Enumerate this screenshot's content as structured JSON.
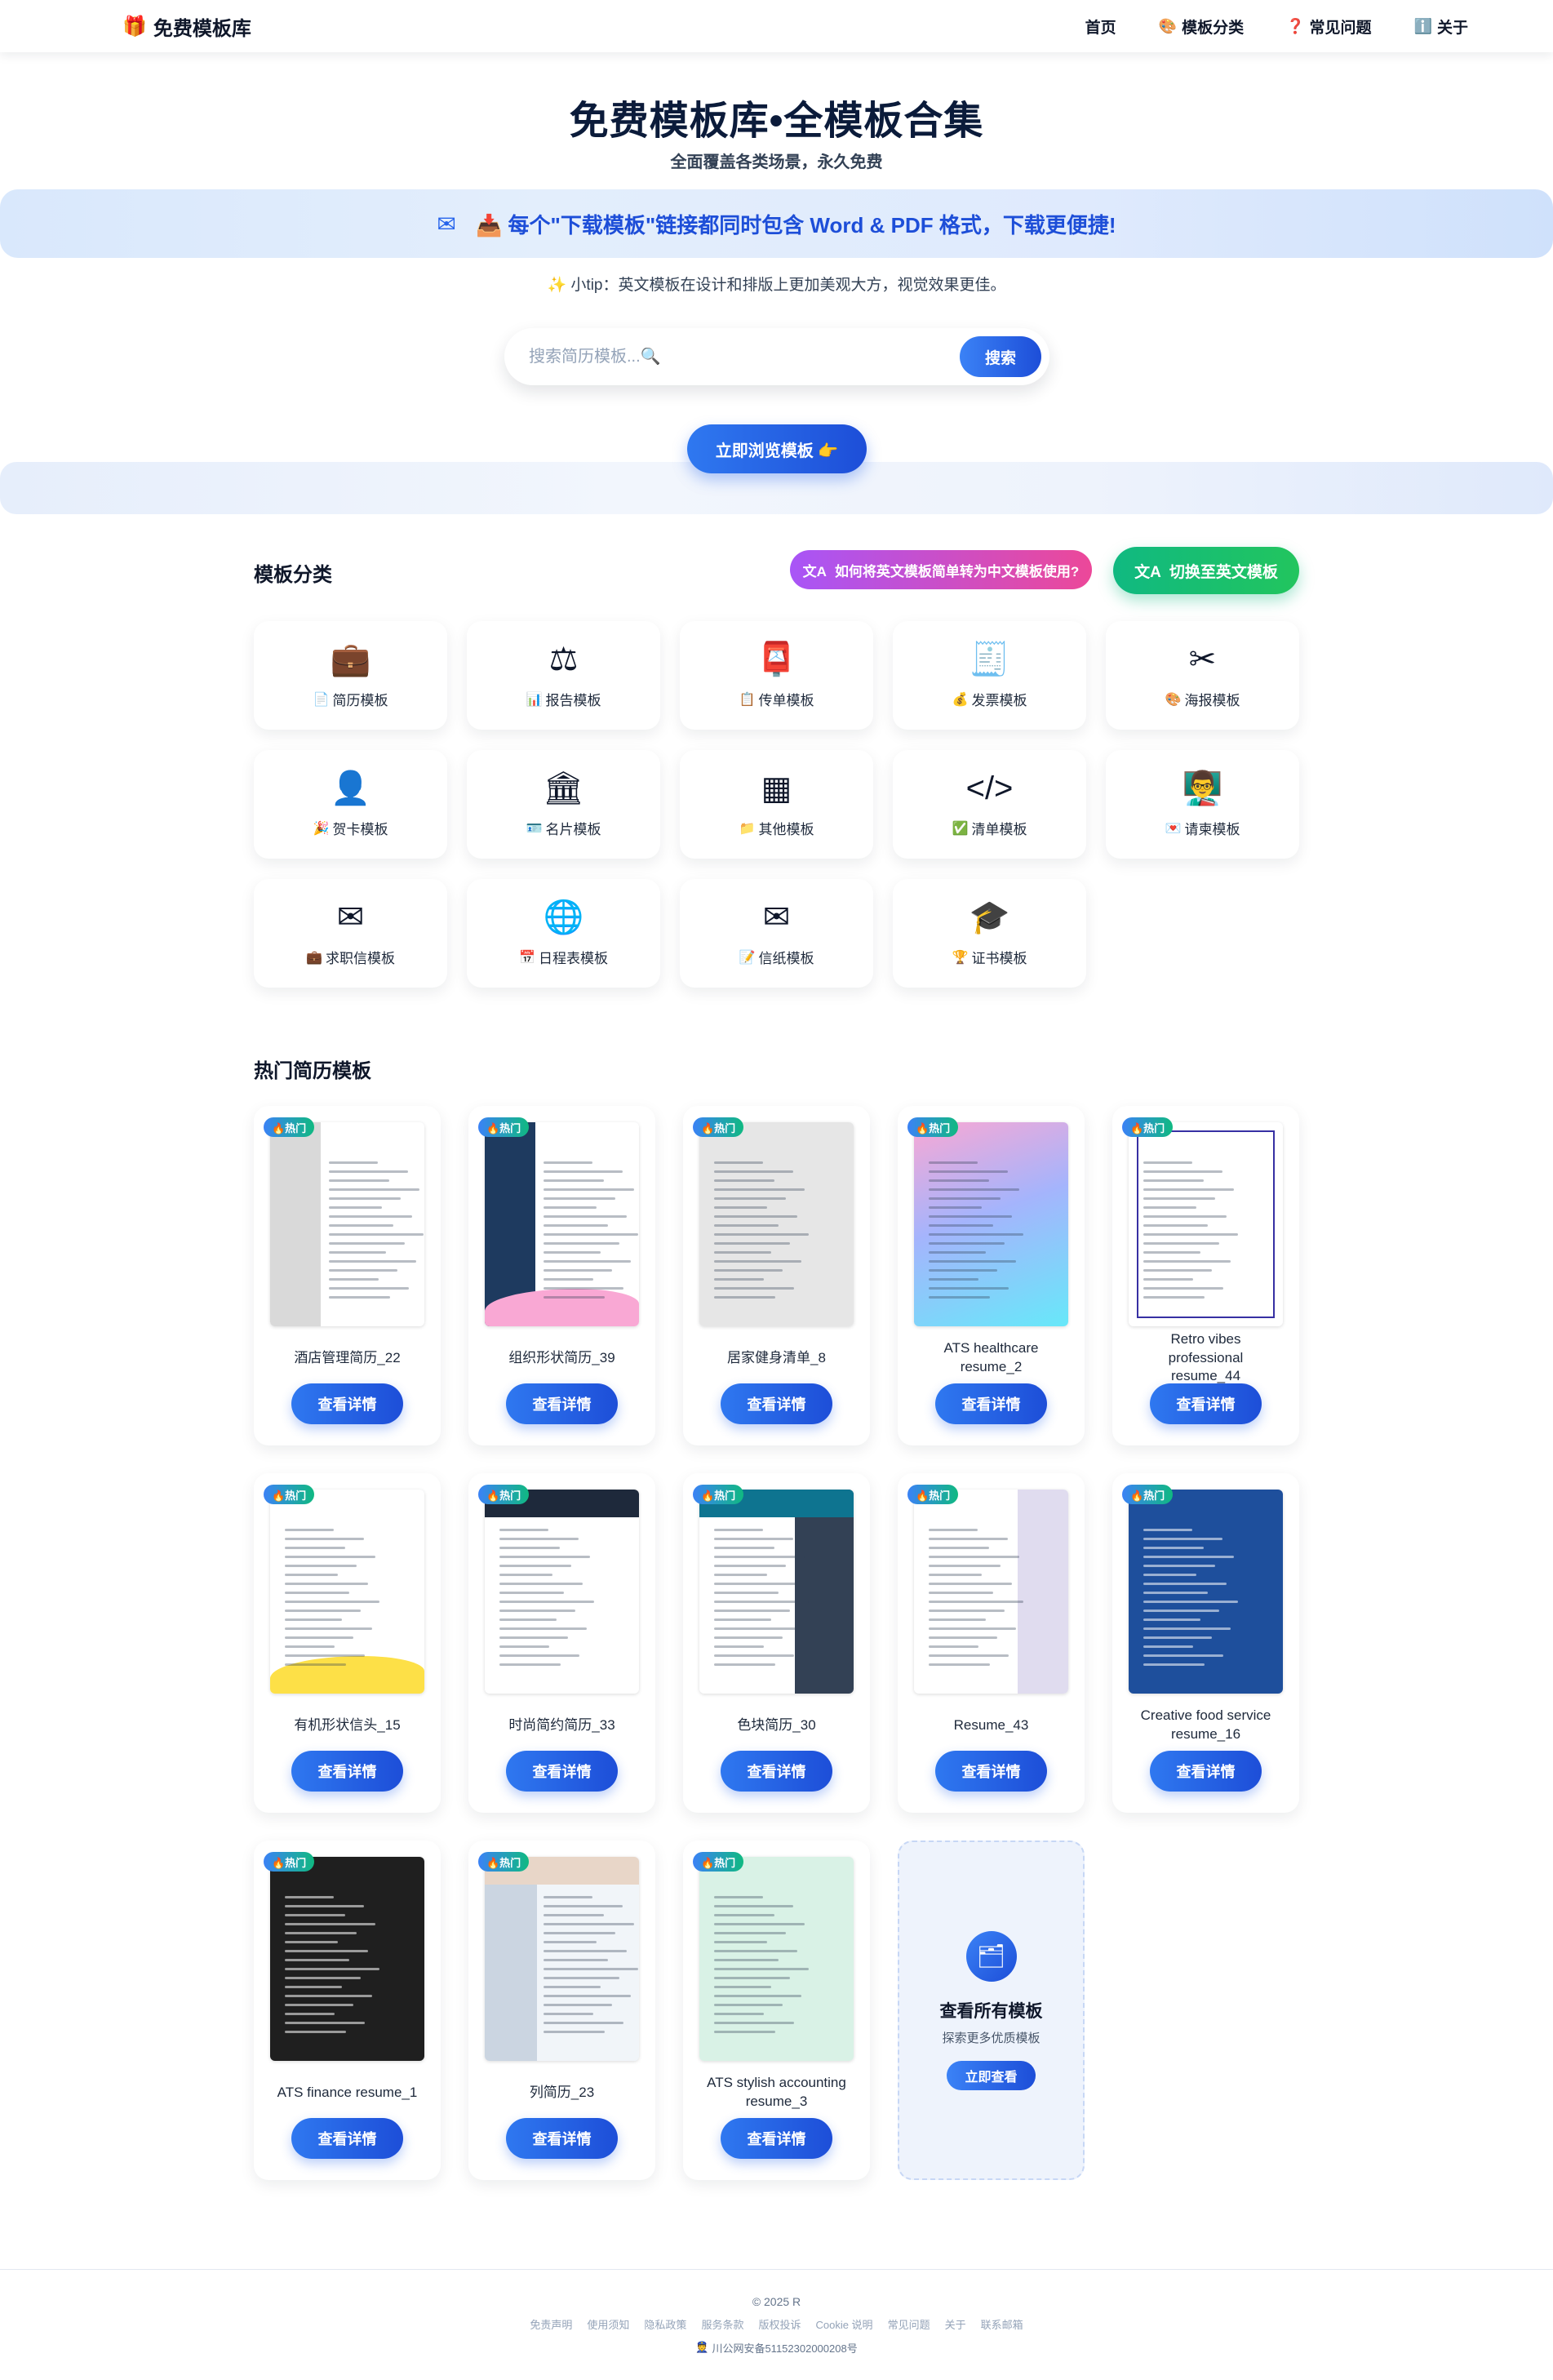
{
  "header": {
    "logo_icon": "🎁",
    "logo_text": "免费模板库",
    "nav": [
      {
        "icon": "",
        "label": "首页"
      },
      {
        "icon": "🎨",
        "label": "模板分类"
      },
      {
        "icon": "❓",
        "label": "常见问题"
      },
      {
        "icon": "ℹ️",
        "label": "关于"
      }
    ]
  },
  "hero": {
    "title": "免费模板库•全模板合集",
    "subtitle": "全面覆盖各类场景，永久免费",
    "banner_icon": "✉",
    "banner_text": "📥 每个\"下载模板\"链接都同时包含 Word & PDF 格式，下载更便捷!",
    "tip": "✨ 小tip：英文模板在设计和排版上更加美观大方，视觉效果更佳。",
    "search_placeholder": "搜索简历模板...🔍",
    "search_button": "搜索",
    "browse_button": "立即浏览模板 👉"
  },
  "categories": {
    "title": "模板分类",
    "howto_button": "如何将英文模板简单转为中文模板使用?",
    "switch_button": "切换至英文模板",
    "items": [
      {
        "icon": "💼",
        "emoji": "📄",
        "label": "简历模板"
      },
      {
        "icon": "⚖",
        "emoji": "📊",
        "label": "报告模板"
      },
      {
        "icon": "📮",
        "emoji": "📋",
        "label": "传单模板"
      },
      {
        "icon": "🧾",
        "emoji": "💰",
        "label": "发票模板"
      },
      {
        "icon": "✂",
        "emoji": "🎨",
        "label": "海报模板"
      },
      {
        "icon": "👤",
        "emoji": "🎉",
        "label": "贺卡模板"
      },
      {
        "icon": "🏛",
        "emoji": "🪪",
        "label": "名片模板"
      },
      {
        "icon": "▦",
        "emoji": "📁",
        "label": "其他模板"
      },
      {
        "icon": "</>",
        "emoji": "✅",
        "label": "清单模板"
      },
      {
        "icon": "👨‍🏫",
        "emoji": "💌",
        "label": "请柬模板"
      },
      {
        "icon": "✉",
        "emoji": "💼",
        "label": "求职信模板"
      },
      {
        "icon": "🌐",
        "emoji": "📅",
        "label": "日程表模板"
      },
      {
        "icon": "✉",
        "emoji": "📝",
        "label": "信纸模板"
      },
      {
        "icon": "🎓",
        "emoji": "🏆",
        "label": "证书模板"
      }
    ]
  },
  "hot": {
    "title": "热门简历模板",
    "badge": "🔥热门",
    "detail_button": "查看详情",
    "items": [
      {
        "name": "酒店管理简历_22",
        "style": "photo-gray"
      },
      {
        "name": "组织形状简历_39",
        "style": "navy-side"
      },
      {
        "name": "居家健身清单_8",
        "style": "gray-list"
      },
      {
        "name": "ATS healthcare resume_2",
        "style": "gradient"
      },
      {
        "name": "Retro vibes professional resume_44",
        "style": "retro-blue"
      },
      {
        "name": "有机形状信头_15",
        "style": "wave"
      },
      {
        "name": "时尚简约简历_33",
        "style": "dark-top"
      },
      {
        "name": "色块简历_30",
        "style": "teal-block"
      },
      {
        "name": "Resume_43",
        "style": "red-lav"
      },
      {
        "name": "Creative food service resume_16",
        "style": "blue-full"
      },
      {
        "name": "ATS finance resume_1",
        "style": "black"
      },
      {
        "name": "列简历_23",
        "style": "columns"
      },
      {
        "name": "ATS stylish accounting resume_3",
        "style": "mint"
      }
    ],
    "view_all": {
      "icon": "🗂",
      "title": "查看所有模板",
      "subtitle": "探索更多优质模板",
      "button": "立即查看"
    }
  },
  "footer": {
    "copyright": "© 2025 R",
    "links": [
      "免责声明",
      "使用须知",
      "隐私政策",
      "服务条款",
      "版权投诉",
      "Cookie 说明",
      "常见问题",
      "关于",
      "联系邮箱"
    ],
    "beian": "川公网安备51152302000208号"
  }
}
